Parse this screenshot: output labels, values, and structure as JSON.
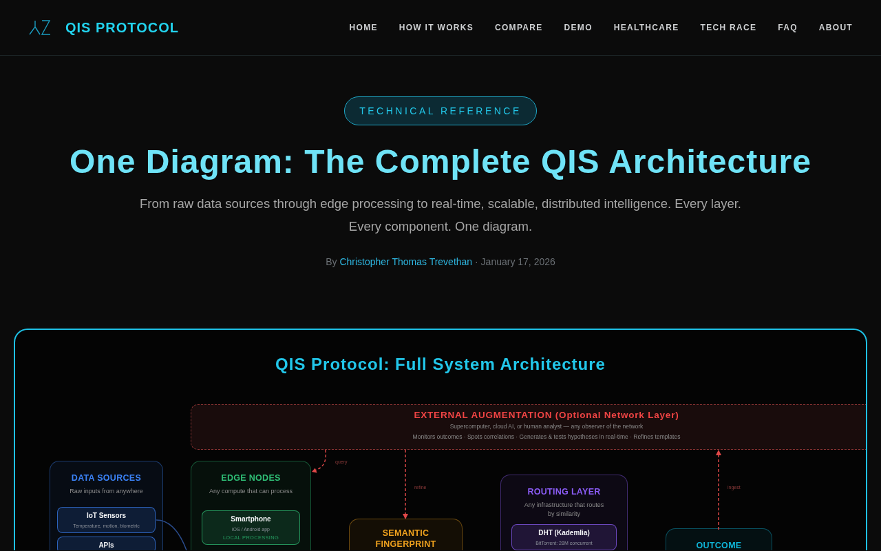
{
  "header": {
    "logo_text": "QIS PROTOCOL",
    "nav": [
      "HOME",
      "HOW IT WORKS",
      "COMPARE",
      "DEMO",
      "HEALTHCARE",
      "TECH RACE",
      "FAQ",
      "ABOUT"
    ]
  },
  "hero": {
    "badge": "TECHNICAL REFERENCE",
    "title": "One Diagram: The Complete QIS Architecture",
    "subtitle": "From raw data sources through edge processing to real-time, scalable, distributed intelligence. Every layer. Every component. One diagram.",
    "byline": {
      "prefix": "By",
      "author": "Christopher Thomas Trevethan",
      "suffix": "· January 17, 2026"
    }
  },
  "diagram": {
    "title": "QIS Protocol: Full System Architecture",
    "external_layer": {
      "title": "EXTERNAL AUGMENTATION (Optional Network Layer)",
      "description": "Supercomputer, cloud AI, or human analyst — any observer of the network",
      "capabilities": "Monitors outcomes · Spots correlations · Generates & tests hypotheses in real-time · Refines templates"
    },
    "arrows": [
      {
        "label": "query"
      },
      {
        "label": "refine"
      },
      {
        "label": "ingest"
      }
    ],
    "layers": [
      {
        "title": "DATA SOURCES",
        "description": "Raw inputs from anywhere",
        "color": "#3b82f6",
        "components": [
          {
            "title": "IoT Sensors",
            "detail": "Temperature, motion, biometric"
          },
          {
            "title": "APIs"
          }
        ]
      },
      {
        "title": "EDGE NODES",
        "description": "Any compute that can process",
        "color": "#2fbf76",
        "components": [
          {
            "title": "Smartphone",
            "detail": "iOS / Android app",
            "tag": "LOCAL PROCESSING"
          }
        ]
      },
      {
        "title": "SEMANTIC FINGERPRINT",
        "color": "#f0a21e"
      },
      {
        "title": "ROUTING LAYER",
        "description": "Any infrastructure that routes by similarity",
        "color": "#8b5cf6",
        "components": [
          {
            "title": "DHT (Kademlia)",
            "detail": "BitTorrent: 28M concurrent"
          }
        ]
      },
      {
        "title": "OUTCOME",
        "color": "#0fb5d8"
      }
    ]
  }
}
